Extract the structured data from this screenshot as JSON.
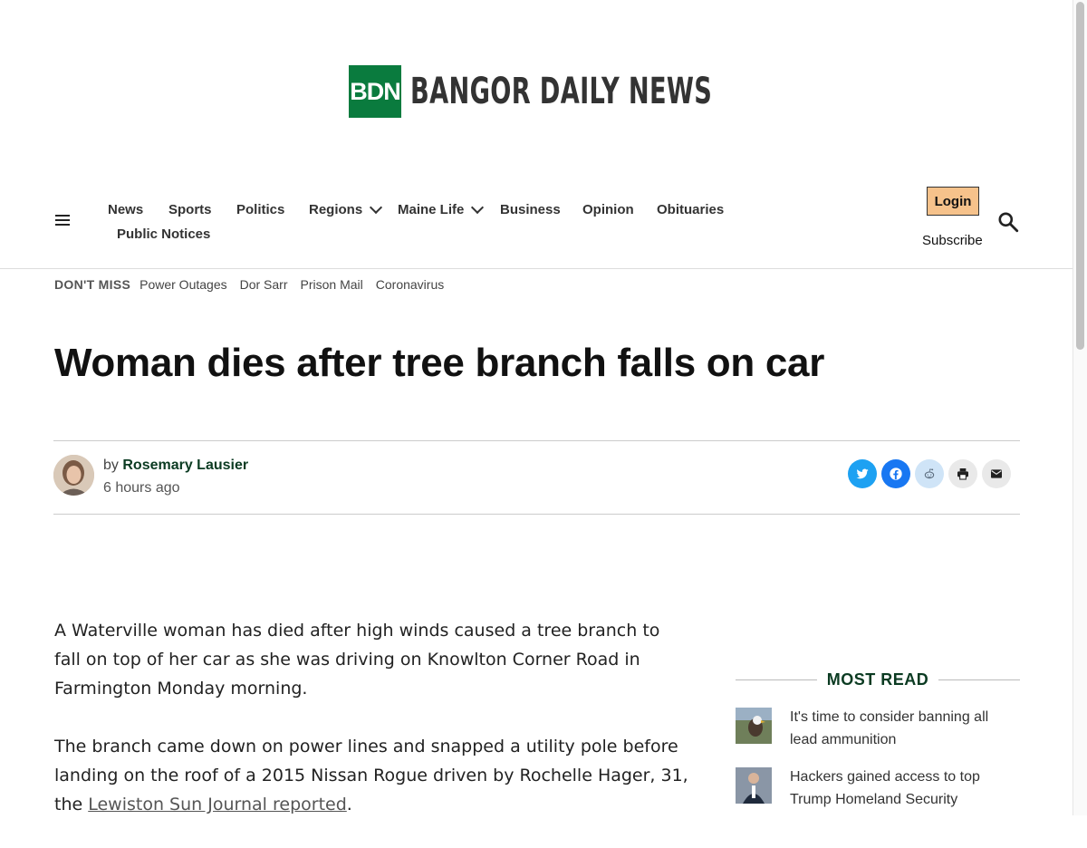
{
  "brand": {
    "mark": "BDN",
    "wordmark": "BANGOR DAILY NEWS",
    "green": "#0a7b3e"
  },
  "nav": {
    "items": [
      {
        "label": "News"
      },
      {
        "label": "Sports"
      },
      {
        "label": "Politics"
      },
      {
        "label": "Regions",
        "dropdown": true
      },
      {
        "label": "Maine Life",
        "dropdown": true
      },
      {
        "label": "Business"
      },
      {
        "label": "Opinion"
      },
      {
        "label": "Obituaries"
      },
      {
        "label": "Public Notices"
      }
    ],
    "login": "Login",
    "subscribe": "Subscribe"
  },
  "dont_miss": {
    "label": "DON'T MISS",
    "links": [
      "Power Outages",
      "Dor Sarr",
      "Prison Mail",
      "Coronavirus"
    ]
  },
  "article": {
    "headline": "Woman dies after tree branch falls on car",
    "by": "by",
    "author": "Rosemary Lausier",
    "time": "6 hours ago",
    "p1": "A Waterville woman has died after high winds caused a tree branch to fall on top of her car as she was driving on Knowlton Corner Road in Farmington Monday morning.",
    "p2_before": "The branch came down on power lines and snapped a utility pole before landing on the roof of a 2015 Nissan Rogue driven by Rochelle Hager, 31, the ",
    "p2_link": "Lewiston Sun Journal reported",
    "p2_after": "."
  },
  "share": [
    {
      "name": "twitter",
      "color": "#1da1f2"
    },
    {
      "name": "facebook",
      "color": "#1877f2"
    },
    {
      "name": "reddit",
      "color": "#cfe4f7"
    },
    {
      "name": "print",
      "color": "#e9e9e9"
    },
    {
      "name": "email",
      "color": "#e9e9e9"
    }
  ],
  "most_read": {
    "title": "MOST READ",
    "items": [
      {
        "title": "It's time to consider banning all lead ammunition"
      },
      {
        "title": "Hackers gained access to top Trump Homeland Security"
      }
    ]
  }
}
